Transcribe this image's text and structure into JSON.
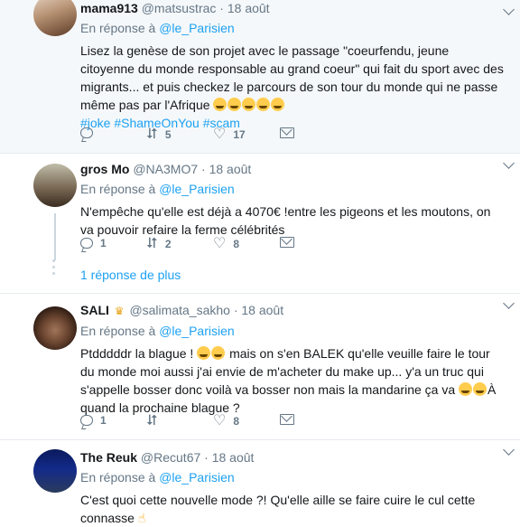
{
  "tweets": [
    {
      "name": "mama913",
      "handle": "@matsustrac",
      "dot": "·",
      "time": "18 août",
      "reply_prefix": "En réponse à",
      "reply_to": "@le_Parisien",
      "text": "Lisez la genèse de son projet avec le passage \"coeurfendu, jeune citoyenne du monde responsable au grand coeur\" qui fait du sport avec des migrants... et puis checkez le parcours de son tour du monde qui ne passe même pas par l'Afrique",
      "hashtags": "#joke #ShameOnYou #scam",
      "replies": "",
      "retweets": "5",
      "likes": "17"
    },
    {
      "name": "gros Mo",
      "handle": "@NA3MO7",
      "dot": "·",
      "time": "18 août",
      "reply_prefix": "En réponse à",
      "reply_to": "@le_Parisien",
      "text": "N'empêche qu'elle est déjà a 4070€ !entre les pigeons et les moutons, on va pouvoir refaire la ferme célébrités",
      "replies": "1",
      "retweets": "2",
      "likes": "8",
      "more_replies": "1 réponse de plus"
    },
    {
      "name": "SALI",
      "handle": "@salimata_sakho",
      "dot": "·",
      "time": "18 août",
      "reply_prefix": "En réponse à",
      "reply_to": "@le_Parisien",
      "text_a": "Ptdddddr la blague !",
      "text_b": "mais on s'en BALEK qu'elle veuille faire le tour du monde moi aussi j'ai envie de m'acheter du make up... y'a un truc qui s'appelle bosser donc voilà va bosser non mais la mandarine ça va",
      "text_c": "À quand la prochaine blague ?",
      "replies": "1",
      "retweets": "",
      "likes": "8"
    },
    {
      "name": "The Reuk",
      "handle": "@Recut67",
      "dot": "·",
      "time": "18 août",
      "reply_prefix": "En réponse à",
      "reply_to": "@le_Parisien",
      "text": "C'est quoi cette nouvelle mode ?! Qu'elle aille se faire cuire le cul cette connasse"
    }
  ],
  "icons": [
    "reply-icon",
    "retweet-icon",
    "like-icon",
    "direct-message-icon",
    "chevron-down-icon",
    "crown-icon"
  ],
  "colors": {
    "link": "#1da1f2",
    "muted": "#657786",
    "text": "#14171a",
    "highlight_bg": "#f5f8fa"
  }
}
